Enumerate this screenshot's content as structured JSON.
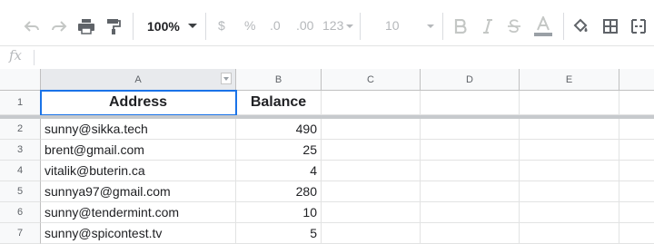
{
  "toolbar": {
    "zoom": "100%",
    "currency": "$",
    "percent": "%",
    "dec_decrease": ".0",
    "dec_increase": ".00",
    "more_formats": "123",
    "font_size": "10"
  },
  "formula_bar": {
    "fx": "fx"
  },
  "columns": [
    "A",
    "B",
    "C",
    "D",
    "E"
  ],
  "rows": [
    {
      "num": "1",
      "address": "Address",
      "balance": "Balance"
    },
    {
      "num": "2",
      "address": "sunny@sikka.tech",
      "balance": "490"
    },
    {
      "num": "3",
      "address": "brent@gmail.com",
      "balance": "25"
    },
    {
      "num": "4",
      "address": "vitalik@buterin.ca",
      "balance": "4"
    },
    {
      "num": "5",
      "address": "sunnya97@gmail.com",
      "balance": "280"
    },
    {
      "num": "6",
      "address": "sunny@tendermint.com",
      "balance": "10"
    },
    {
      "num": "7",
      "address": "sunny@spicontest.tv",
      "balance": "5"
    }
  ],
  "colors": {
    "selection": "#1a73e8",
    "header_bg": "#f8f9fa",
    "freeze_bar": "#c7cacd"
  }
}
